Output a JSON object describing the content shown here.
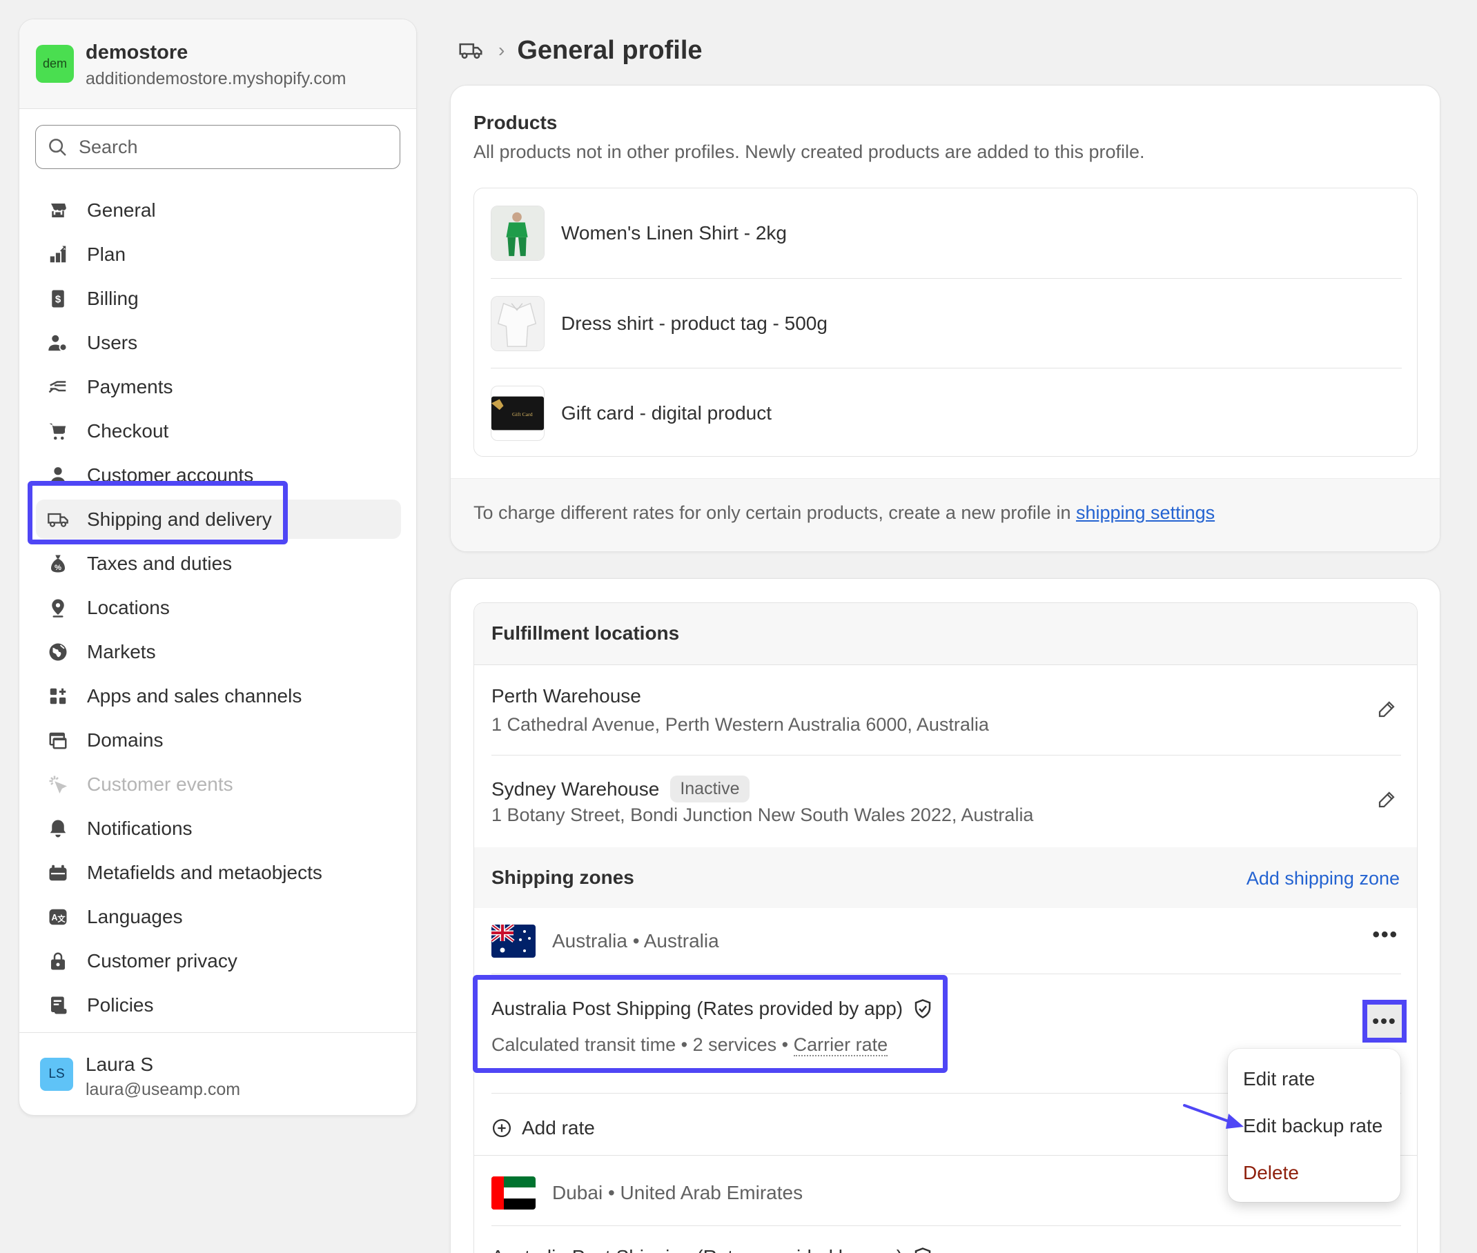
{
  "store": {
    "badge": "dem",
    "name": "demostore",
    "url": "additiondemostore.myshopify.com"
  },
  "search": {
    "placeholder": "Search"
  },
  "nav": [
    {
      "label": "General",
      "icon": "store-icon"
    },
    {
      "label": "Plan",
      "icon": "plan-icon"
    },
    {
      "label": "Billing",
      "icon": "billing-icon"
    },
    {
      "label": "Users",
      "icon": "users-icon"
    },
    {
      "label": "Payments",
      "icon": "payments-icon"
    },
    {
      "label": "Checkout",
      "icon": "cart-icon"
    },
    {
      "label": "Customer accounts",
      "icon": "person-icon"
    },
    {
      "label": "Shipping and delivery",
      "icon": "truck-icon",
      "active": true
    },
    {
      "label": "Taxes and duties",
      "icon": "tax-icon"
    },
    {
      "label": "Locations",
      "icon": "location-pin-icon"
    },
    {
      "label": "Markets",
      "icon": "globe-icon"
    },
    {
      "label": "Apps and sales channels",
      "icon": "apps-icon"
    },
    {
      "label": "Domains",
      "icon": "domains-icon"
    },
    {
      "label": "Customer events",
      "icon": "cursor-click-icon",
      "disabled": true
    },
    {
      "label": "Notifications",
      "icon": "bell-icon"
    },
    {
      "label": "Metafields and metaobjects",
      "icon": "metafields-icon"
    },
    {
      "label": "Languages",
      "icon": "language-icon"
    },
    {
      "label": "Customer privacy",
      "icon": "lock-icon"
    },
    {
      "label": "Policies",
      "icon": "policies-icon"
    }
  ],
  "user": {
    "initials": "LS",
    "name": "Laura S",
    "email": "laura@useamp.com"
  },
  "header": {
    "title": "General profile",
    "icon": "truck-icon"
  },
  "products": {
    "title": "Products",
    "subtitle": "All products not in other profiles. Newly created products are added to this profile.",
    "items": [
      {
        "name": "Women's Linen Shirt - 2kg"
      },
      {
        "name": "Dress shirt - product tag - 500g"
      },
      {
        "name": "Gift card - digital product",
        "thumb_text": "Gift Card"
      }
    ],
    "footer_text": "To charge different rates for only certain products, create a new profile in ",
    "footer_link": "shipping settings"
  },
  "fulfillment": {
    "title": "Fulfillment locations",
    "locations": [
      {
        "name": "Perth Warehouse",
        "address": "1 Cathedral Avenue, Perth Western Australia 6000, Australia"
      },
      {
        "name": "Sydney Warehouse",
        "badge": "Inactive",
        "address": "1 Botany Street, Bondi Junction New South Wales 2022, Australia"
      }
    ]
  },
  "zones": {
    "title": "Shipping zones",
    "add_label": "Add shipping zone",
    "list": [
      {
        "name": "Australia • Australia",
        "rate_title": "Australia Post Shipping (Rates provided by app)",
        "rate_sub_a": "Calculated transit time • 2 services • ",
        "rate_sub_b": "Carrier rate"
      },
      {
        "name": "Dubai • United Arab Emirates",
        "rate_title": "Australia Post Shipping (Rates provided by app)"
      }
    ],
    "add_rate": "Add rate",
    "more": "•••"
  },
  "menu": {
    "items": [
      "Edit rate",
      "Edit backup rate",
      "Delete"
    ]
  },
  "colors": {
    "highlight": "#4f46f5",
    "link": "#2463d1",
    "danger": "#8e1f0b"
  }
}
